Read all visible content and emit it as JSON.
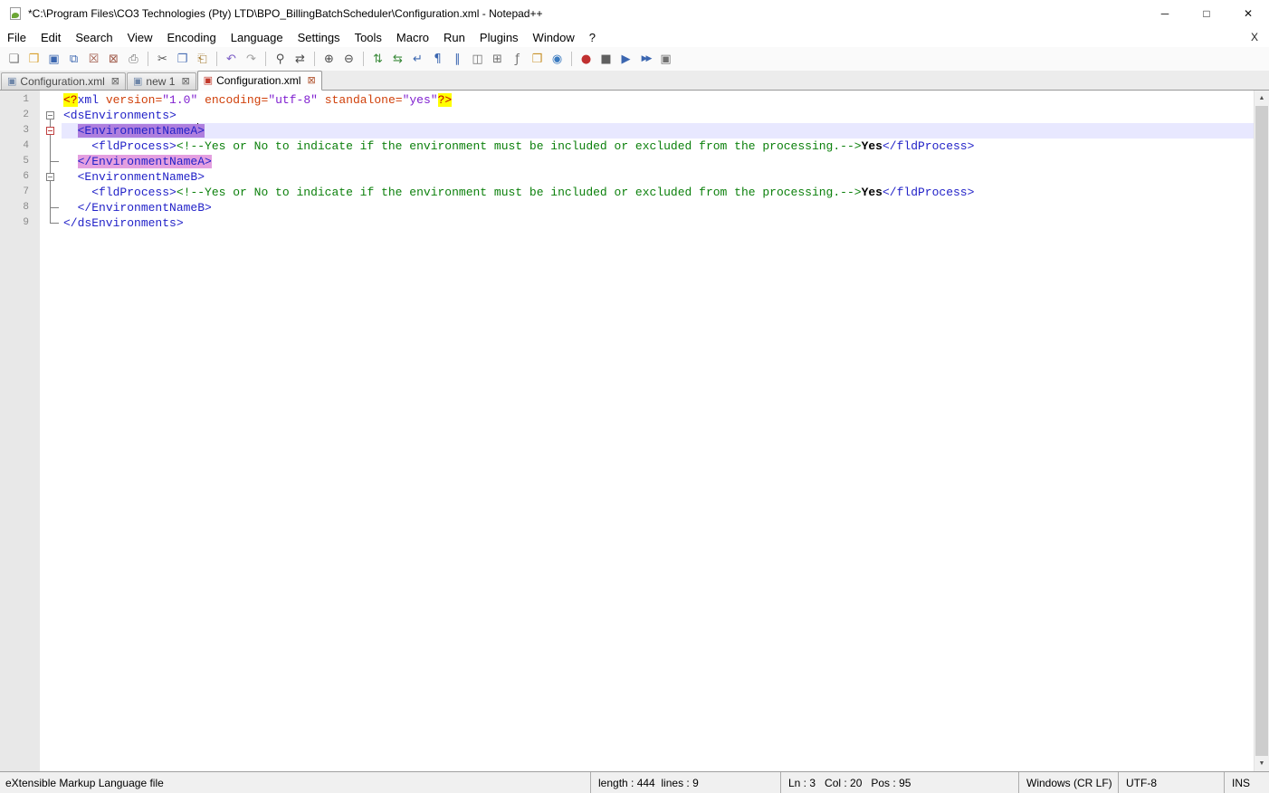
{
  "window": {
    "title": "*C:\\Program Files\\CO3 Technologies (Pty) LTD\\BPO_BillingBatchScheduler\\Configuration.xml - Notepad++",
    "controls": {
      "minimize": "─",
      "maximize": "□",
      "close": "✕"
    }
  },
  "menubar": {
    "items": [
      "File",
      "Edit",
      "Search",
      "View",
      "Encoding",
      "Language",
      "Settings",
      "Tools",
      "Macro",
      "Run",
      "Plugins",
      "Window",
      "?"
    ],
    "right_close": "X"
  },
  "toolbar": {
    "items": [
      {
        "name": "new-file-icon",
        "glyph": "❏",
        "color": "#707070"
      },
      {
        "name": "open-folder-icon",
        "glyph": "❒",
        "color": "#d8a02e"
      },
      {
        "name": "save-icon",
        "glyph": "▣",
        "color": "#3b66b0"
      },
      {
        "name": "save-all-icon",
        "glyph": "⧉",
        "color": "#3b66b0"
      },
      {
        "name": "close-file-icon",
        "glyph": "☒",
        "color": "#a05a4a"
      },
      {
        "name": "close-all-icon",
        "glyph": "⊠",
        "color": "#a05a4a"
      },
      {
        "name": "print-icon",
        "glyph": "⎙",
        "color": "#707070"
      },
      {
        "sep": true
      },
      {
        "name": "cut-icon",
        "glyph": "✂",
        "color": "#555555"
      },
      {
        "name": "copy-icon",
        "glyph": "❐",
        "color": "#4a6fb5"
      },
      {
        "name": "paste-icon",
        "glyph": "⎗",
        "color": "#a8803a"
      },
      {
        "sep": true
      },
      {
        "name": "undo-icon",
        "glyph": "↶",
        "color": "#7a5cc5"
      },
      {
        "name": "redo-icon",
        "glyph": "↷",
        "color": "#a0a0a0"
      },
      {
        "sep": true
      },
      {
        "name": "find-icon",
        "glyph": "⚲",
        "color": "#4a4a4a"
      },
      {
        "name": "replace-icon",
        "glyph": "⇄",
        "color": "#4a4a4a"
      },
      {
        "sep": true
      },
      {
        "name": "zoom-in-icon",
        "glyph": "⊕",
        "color": "#4a4a4a"
      },
      {
        "name": "zoom-out-icon",
        "glyph": "⊖",
        "color": "#4a4a4a"
      },
      {
        "sep": true
      },
      {
        "name": "sync-vertical-scroll-icon",
        "glyph": "⇅",
        "color": "#3a8a3a"
      },
      {
        "name": "sync-horizontal-scroll-icon",
        "glyph": "⇆",
        "color": "#3a8a3a"
      },
      {
        "name": "word-wrap-icon",
        "glyph": "↵",
        "color": "#3b66b0"
      },
      {
        "name": "show-all-characters-icon",
        "glyph": "¶",
        "color": "#3b66b0"
      },
      {
        "name": "show-indent-guide-icon",
        "glyph": "∥",
        "color": "#3b66b0"
      },
      {
        "name": "user-defined-dialog-icon",
        "glyph": "◫",
        "color": "#707070"
      },
      {
        "name": "document-map-icon",
        "glyph": "⊞",
        "color": "#707070"
      },
      {
        "name": "function-list-icon",
        "glyph": "ƒ",
        "color": "#707070"
      },
      {
        "name": "folder-as-workspace-icon",
        "glyph": "❒",
        "color": "#c8922a"
      },
      {
        "name": "monitoring-icon",
        "glyph": "◉",
        "color": "#3a7abf"
      },
      {
        "sep": true
      },
      {
        "name": "record-macro-icon",
        "glyph": "●",
        "color": "#c03030"
      },
      {
        "name": "stop-recording-icon",
        "glyph": "■",
        "color": "#606060"
      },
      {
        "name": "playback-macro-icon",
        "glyph": "▶",
        "color": "#3b66b0"
      },
      {
        "name": "run-macro-multiple-times-icon",
        "glyph": "▶▶",
        "color": "#3b66b0",
        "small": true
      },
      {
        "name": "save-recorded-macro-icon",
        "glyph": "▣",
        "color": "#707070"
      }
    ]
  },
  "tabbar": {
    "doc_icon_glyph": "▣",
    "close_glyph": "⊠",
    "tabs": [
      {
        "label": "Configuration.xml",
        "active": false,
        "modified": false,
        "icon_color": "#6e86a8"
      },
      {
        "label": "new 1",
        "active": false,
        "modified": false,
        "icon_color": "#6e86a8"
      },
      {
        "label": "Configuration.xml",
        "active": true,
        "modified": true,
        "icon_color": "#c2382a"
      }
    ]
  },
  "editor": {
    "colors": {
      "tag": "#2222c8",
      "attr": "#d0400a",
      "value": "#8020d0",
      "comment": "#0c800c",
      "decl_fg": "#c00000",
      "decl_bg": "#ffff00",
      "tag_open_bg": "#af7fde",
      "tag_close_bg": "#e49fe0",
      "current_line_bg": "#e8e8ff"
    },
    "lines": [
      {
        "num": 1,
        "fold": "",
        "current": false,
        "tokens": [
          {
            "t": "<?",
            "c": "decl"
          },
          {
            "t": "xml",
            "c": "tag"
          },
          {
            "t": " ",
            "c": "plain"
          },
          {
            "t": "version",
            "c": "attr"
          },
          {
            "t": "=",
            "c": "attr"
          },
          {
            "t": "\"1.0\"",
            "c": "value"
          },
          {
            "t": " ",
            "c": "plain"
          },
          {
            "t": "encoding",
            "c": "attr"
          },
          {
            "t": "=",
            "c": "attr"
          },
          {
            "t": "\"utf-8\"",
            "c": "value"
          },
          {
            "t": " ",
            "c": "plain"
          },
          {
            "t": "standalone",
            "c": "attr"
          },
          {
            "t": "=",
            "c": "attr"
          },
          {
            "t": "\"yes\"",
            "c": "value"
          },
          {
            "t": "?>",
            "c": "decl"
          }
        ]
      },
      {
        "num": 2,
        "fold": "box-down",
        "current": false,
        "tokens": [
          {
            "t": "<dsEnvironments>",
            "c": "tag"
          }
        ]
      },
      {
        "num": 3,
        "fold": "up-boxred-down",
        "current": true,
        "tokens": [
          {
            "t": "  ",
            "c": "plain"
          },
          {
            "t": "<EnvironmentNameA",
            "c": "tagA"
          },
          {
            "c": "caret"
          },
          {
            "t": ">",
            "c": "tagA"
          }
        ]
      },
      {
        "num": 4,
        "fold": "v",
        "current": false,
        "tokens": [
          {
            "t": "    ",
            "c": "plain"
          },
          {
            "t": "<fldProcess>",
            "c": "tag"
          },
          {
            "t": "<!--Yes or No to indicate if the environment must be included or excluded from the processing.-->",
            "c": "comment"
          },
          {
            "t": "Yes",
            "c": "bold"
          },
          {
            "t": "</fldProcess>",
            "c": "tag"
          }
        ]
      },
      {
        "num": 5,
        "fold": "v-tick",
        "current": false,
        "tokens": [
          {
            "t": "  ",
            "c": "plain"
          },
          {
            "t": "</EnvironmentNameA>",
            "c": "tagB"
          }
        ]
      },
      {
        "num": 6,
        "fold": "up-box-down",
        "current": false,
        "tokens": [
          {
            "t": "  ",
            "c": "plain"
          },
          {
            "t": "<EnvironmentNameB>",
            "c": "tag"
          }
        ]
      },
      {
        "num": 7,
        "fold": "v",
        "current": false,
        "tokens": [
          {
            "t": "    ",
            "c": "plain"
          },
          {
            "t": "<fldProcess>",
            "c": "tag"
          },
          {
            "t": "<!--Yes or No to indicate if the environment must be included or excluded from the processing.-->",
            "c": "comment"
          },
          {
            "t": "Yes",
            "c": "bold"
          },
          {
            "t": "</fldProcess>",
            "c": "tag"
          }
        ]
      },
      {
        "num": 8,
        "fold": "v-tick",
        "current": false,
        "tokens": [
          {
            "t": "  ",
            "c": "plain"
          },
          {
            "t": "</EnvironmentNameB>",
            "c": "tagB_none",
            "alt": "tag"
          }
        ]
      },
      {
        "num": 9,
        "fold": "up-tick",
        "current": false,
        "tokens": [
          {
            "t": "</dsEnvironments>",
            "c": "tag"
          }
        ]
      }
    ]
  },
  "scrollbar": {
    "up": "▲",
    "down": "▼"
  },
  "statusbar": {
    "doctype": "eXtensible Markup Language file",
    "length_lines": "length : 444  lines : 9",
    "cursor": "Ln : 3   Col : 20   Pos : 95",
    "eol": "Windows (CR LF)",
    "encoding": "UTF-8",
    "ins": "INS"
  }
}
